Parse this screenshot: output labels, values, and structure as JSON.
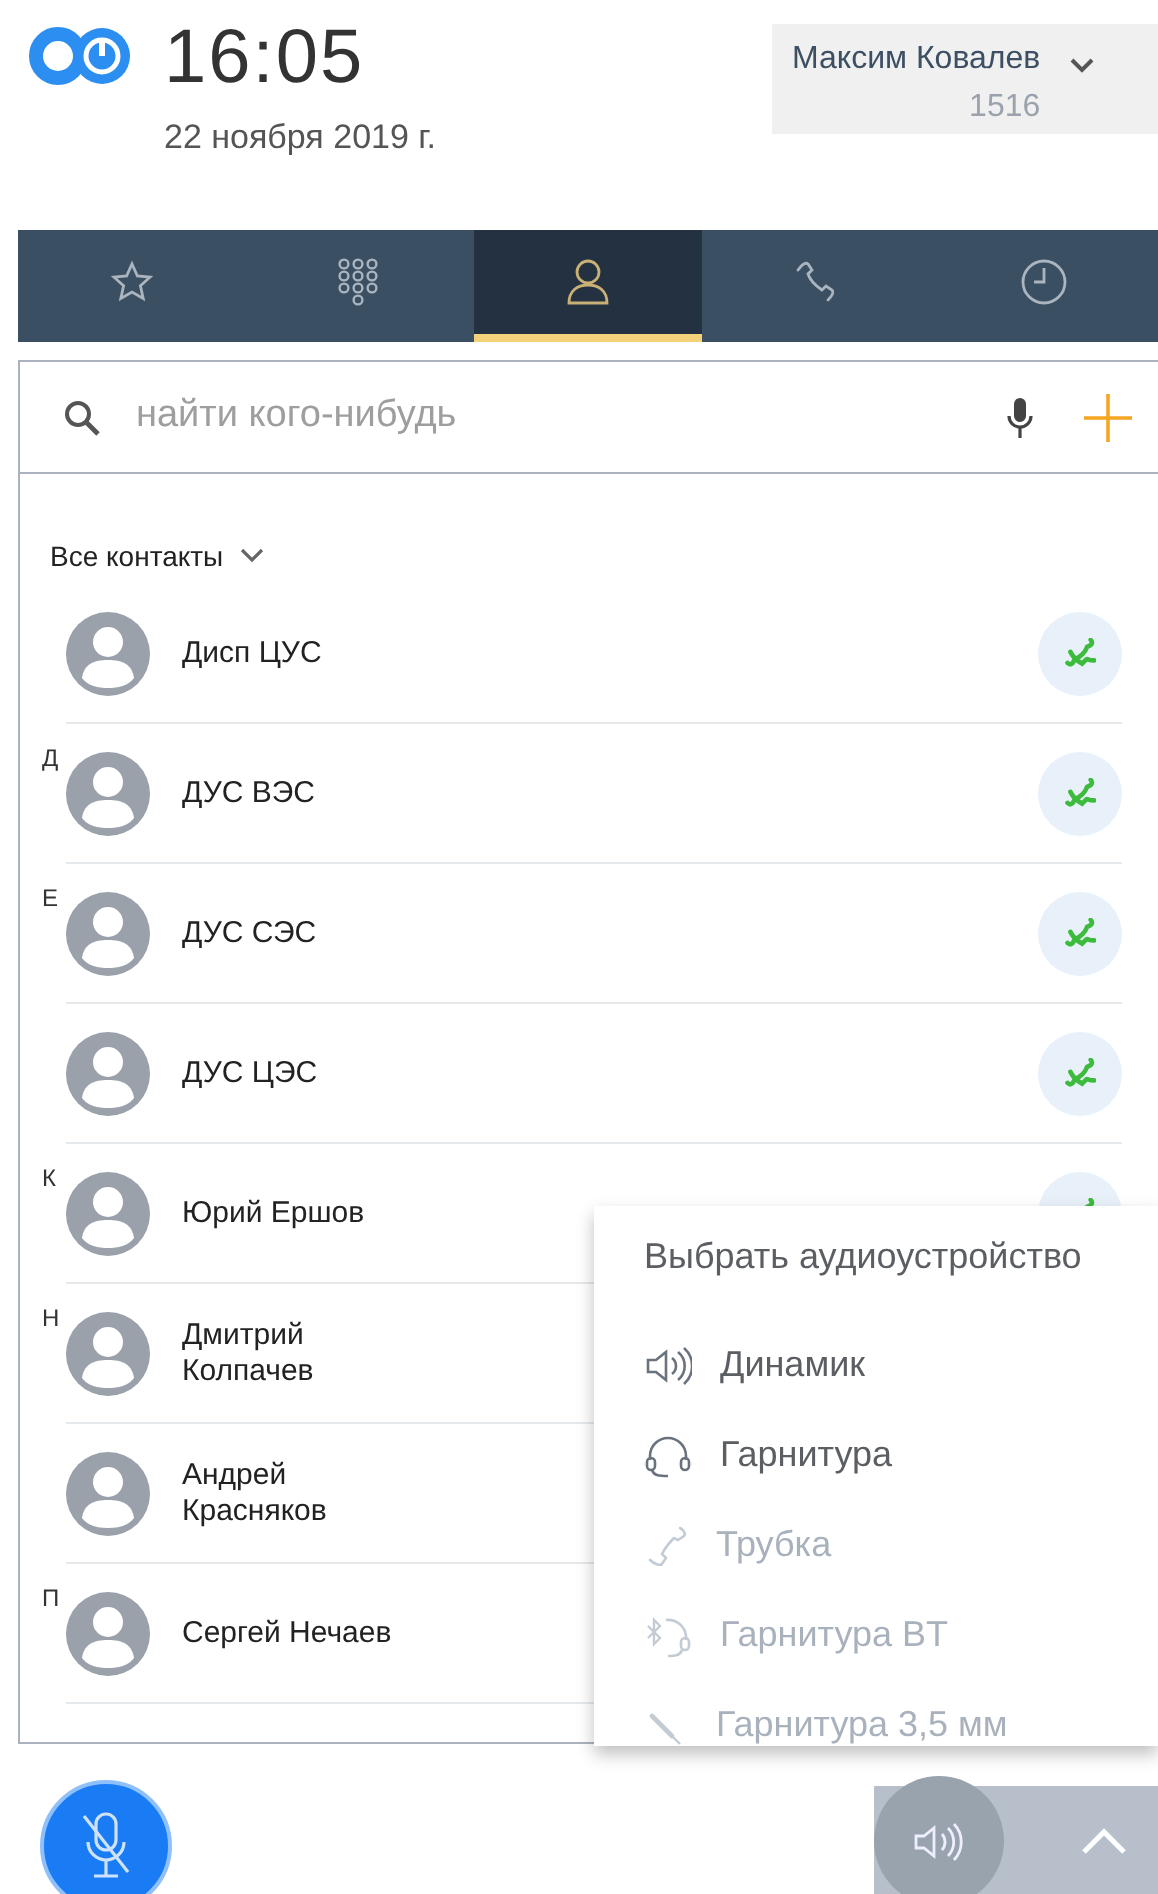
{
  "header": {
    "time": "16:05",
    "date": "22 ноября 2019 г.",
    "user": {
      "name": "Максим Ковалев",
      "extension": "1516"
    }
  },
  "tabs": [
    {
      "kind": "favorites",
      "selected": false
    },
    {
      "kind": "dialpad",
      "selected": false
    },
    {
      "kind": "contacts",
      "selected": true
    },
    {
      "kind": "calls",
      "selected": false
    },
    {
      "kind": "history",
      "selected": false
    }
  ],
  "search": {
    "placeholder": "найти кого-нибудь"
  },
  "filter": {
    "label": "Все контакты"
  },
  "contacts": [
    {
      "name": "Дисп ЦУС",
      "call_button": true
    },
    {
      "letter": "Д",
      "name": "ДУС ВЭС",
      "call_button": true
    },
    {
      "letter": "Е",
      "name": "ДУС СЭС",
      "call_button": true
    },
    {
      "name": "ДУС ЦЭС",
      "call_button": true
    },
    {
      "letter": "К",
      "name": "Юрий Ершов",
      "call_button": true
    },
    {
      "letter": "Н",
      "name": "Дмитрий\nКолпачев",
      "call_button": false
    },
    {
      "name": "Андрей\nКрасняков",
      "call_button": false
    },
    {
      "letter": "П",
      "name": "Сергей Нечаев",
      "call_button": false
    }
  ],
  "audio_menu": {
    "title": "Выбрать аудиоустройство",
    "items": [
      {
        "kind": "speaker",
        "label": "Динамик",
        "disabled": false
      },
      {
        "kind": "headset",
        "label": "Гарнитура",
        "disabled": false
      },
      {
        "kind": "handset",
        "label": "Трубка",
        "disabled": true
      },
      {
        "kind": "bluetooth",
        "label": "Гарнитура BT",
        "disabled": true
      },
      {
        "kind": "jack",
        "label": "Гарнитура 3,5 мм",
        "disabled": true
      }
    ]
  },
  "mic": {
    "muted": true
  },
  "speaker_toggle": {
    "on": true
  }
}
